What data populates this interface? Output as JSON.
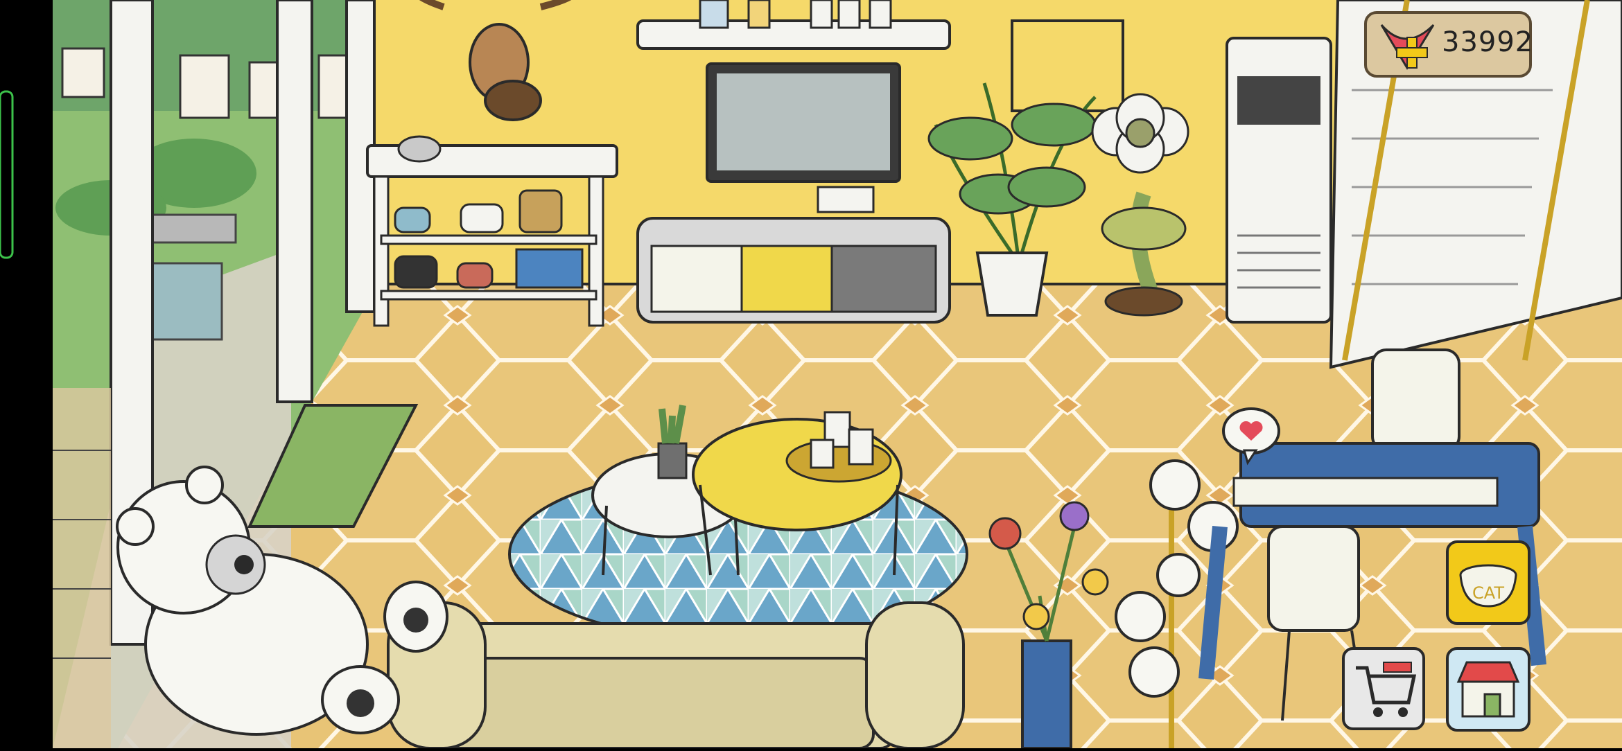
{
  "game": {
    "scene": "living-room",
    "hearts_currency": {
      "icon": "heart-plus-icon",
      "value": "33992"
    },
    "buttons": {
      "cat_food_label": "CAT",
      "cart_icon": "shopping-cart-icon",
      "shop_icon": "shop-house-icon"
    },
    "speech_bubble_icon": "heart-icon"
  },
  "colors": {
    "wall": "#f5d96a",
    "floor": "#e8c476",
    "floor_diamond": "#e0a95a",
    "outline": "#2a2a2a",
    "table_blue": "#3f6ca8",
    "cat_badge": "#f2c919",
    "shop_badge": "#cfe8f3",
    "wood_panel": "#dcc8a0",
    "edge_tab": "#3cc24a"
  }
}
